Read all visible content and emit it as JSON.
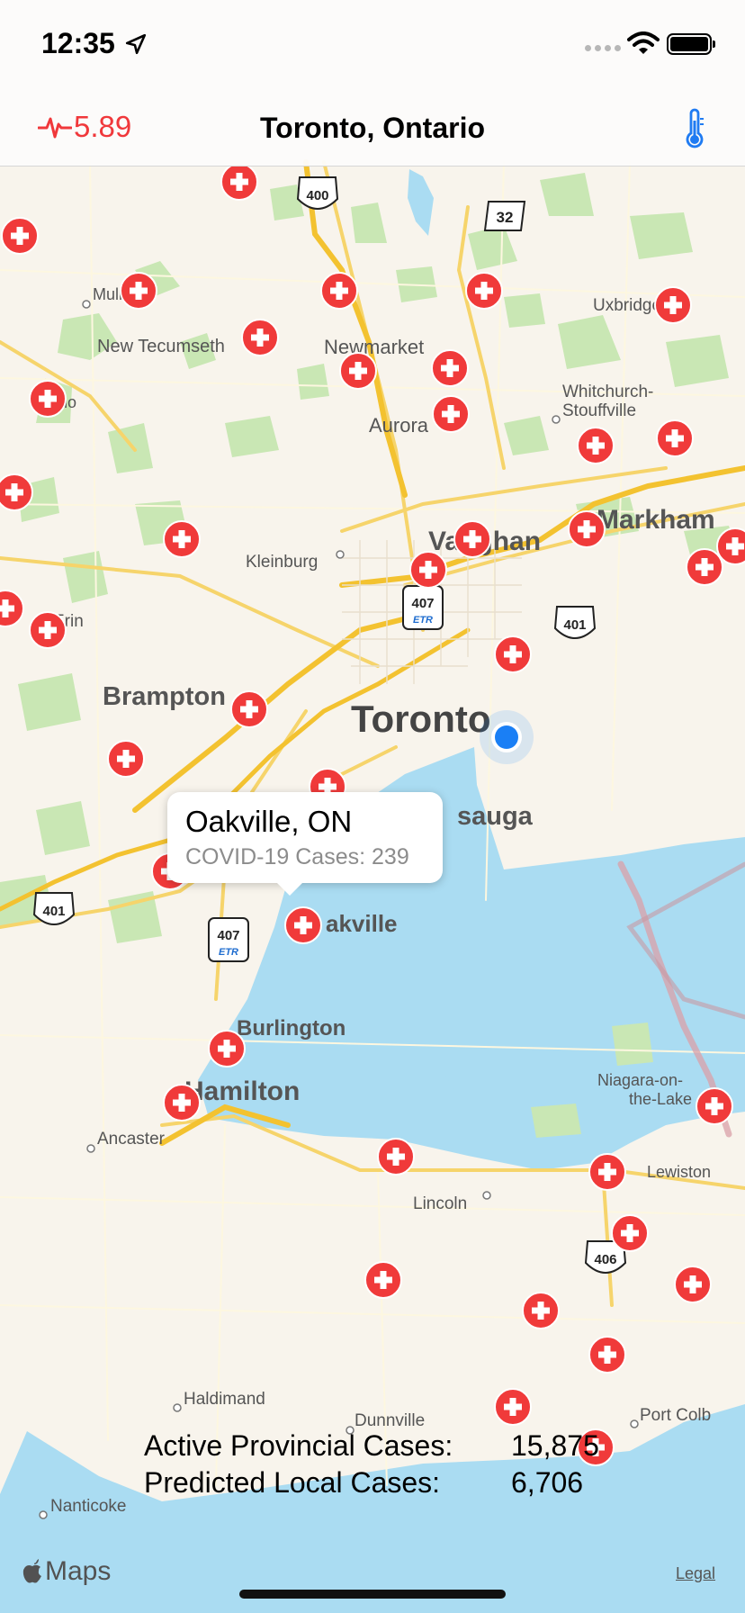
{
  "status_bar": {
    "time": "12:35"
  },
  "nav_bar": {
    "risk_value": "5.89",
    "title": "Toronto, Ontario"
  },
  "callout": {
    "title": "Oakville, ON",
    "subtitle": "COVID-19 Cases: 239"
  },
  "stats": {
    "active_label": "Active Provincial Cases:",
    "active_value": "15,875",
    "predicted_label": "Predicted Local Cases:",
    "predicted_value": "6,706"
  },
  "footer": {
    "maps_label": "Maps",
    "legal_label": "Legal"
  },
  "map": {
    "place_labels": [
      {
        "name": "label-mulmur",
        "text": "Mulmur",
        "cls": "s"
      },
      {
        "name": "label-new-tecumseth",
        "text": "New Tecumseth",
        "cls": "s"
      },
      {
        "name": "label-newmarket",
        "text": "Newmarket",
        "cls": "m"
      },
      {
        "name": "label-mono",
        "text": "Mono",
        "cls": "s"
      },
      {
        "name": "label-aurora",
        "text": "Aurora",
        "cls": "m"
      },
      {
        "name": "label-whitchurch-1",
        "text": "Whitchurch-",
        "cls": "s"
      },
      {
        "name": "label-whitchurch-2",
        "text": "Stouffville",
        "cls": "s"
      },
      {
        "name": "label-uxbridge",
        "text": "Uxbridge",
        "cls": "s"
      },
      {
        "name": "label-markham",
        "text": "Markham",
        "cls": "l"
      },
      {
        "name": "label-vaughan",
        "text": "Vaughan",
        "cls": "l"
      },
      {
        "name": "label-kleinburg",
        "text": "Kleinburg",
        "cls": "s"
      },
      {
        "name": "label-erin",
        "text": "Erin",
        "cls": "s"
      },
      {
        "name": "label-brampton",
        "text": "Brampton",
        "cls": "l"
      },
      {
        "name": "label-toronto",
        "text": "Toronto",
        "cls": "xl"
      },
      {
        "name": "label-mississauga",
        "text": "sauga",
        "cls": "l"
      },
      {
        "name": "label-oakville",
        "text": "akville",
        "cls": "m"
      },
      {
        "name": "label-burlington",
        "text": "Burlington",
        "cls": "m"
      },
      {
        "name": "label-hamilton",
        "text": "Hamilton",
        "cls": "l"
      },
      {
        "name": "label-ancaster",
        "text": "Ancaster",
        "cls": "s"
      },
      {
        "name": "label-niagara-1",
        "text": "Niagara-on-",
        "cls": "s"
      },
      {
        "name": "label-niagara-2",
        "text": "the-Lake",
        "cls": "s"
      },
      {
        "name": "label-lewiston",
        "text": "Lewiston",
        "cls": "s"
      },
      {
        "name": "label-lincoln",
        "text": "Lincoln",
        "cls": "s"
      },
      {
        "name": "label-haldimand",
        "text": "Haldimand",
        "cls": "s"
      },
      {
        "name": "label-dunnville",
        "text": "Dunnville",
        "cls": "s"
      },
      {
        "name": "label-port-colborne",
        "text": "Port Colb",
        "cls": "s"
      },
      {
        "name": "label-nanticoke",
        "text": "Nanticoke",
        "cls": "s"
      }
    ],
    "highway_shields": [
      {
        "name": "highway-400-shield",
        "number": "400",
        "kind": "king"
      },
      {
        "name": "highway-32-shield",
        "number": "32",
        "kind": "county"
      },
      {
        "name": "highway-407-shield-north",
        "number": "407",
        "kind": "etr",
        "sub": "ETR"
      },
      {
        "name": "highway-401-shield-east",
        "number": "401",
        "kind": "king"
      },
      {
        "name": "highway-401-shield-west",
        "number": "401",
        "kind": "king"
      },
      {
        "name": "highway-407-shield-west",
        "number": "407",
        "kind": "etr",
        "sub": "ETR"
      },
      {
        "name": "highway-406-shield",
        "number": "406",
        "kind": "king"
      }
    ]
  }
}
